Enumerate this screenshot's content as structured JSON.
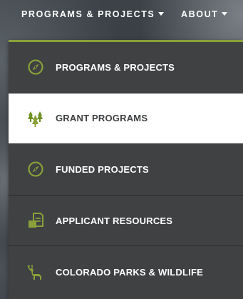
{
  "topnav": {
    "programs_label": "PROGRAMS & PROJECTS",
    "about_label": "ABOUT"
  },
  "dropdown": {
    "accent_color": "#8aa03a",
    "items": [
      {
        "label": "PROGRAMS & PROJECTS",
        "icon": "compass-icon",
        "active": false
      },
      {
        "label": "GRANT PROGRAMS",
        "icon": "trees-icon",
        "active": true
      },
      {
        "label": "FUNDED PROJECTS",
        "icon": "compass-icon",
        "active": false
      },
      {
        "label": "APPLICANT RESOURCES",
        "icon": "document-icon",
        "active": false
      },
      {
        "label": "COLORADO PARKS & WILDLIFE",
        "icon": "elk-icon",
        "active": false
      }
    ]
  }
}
